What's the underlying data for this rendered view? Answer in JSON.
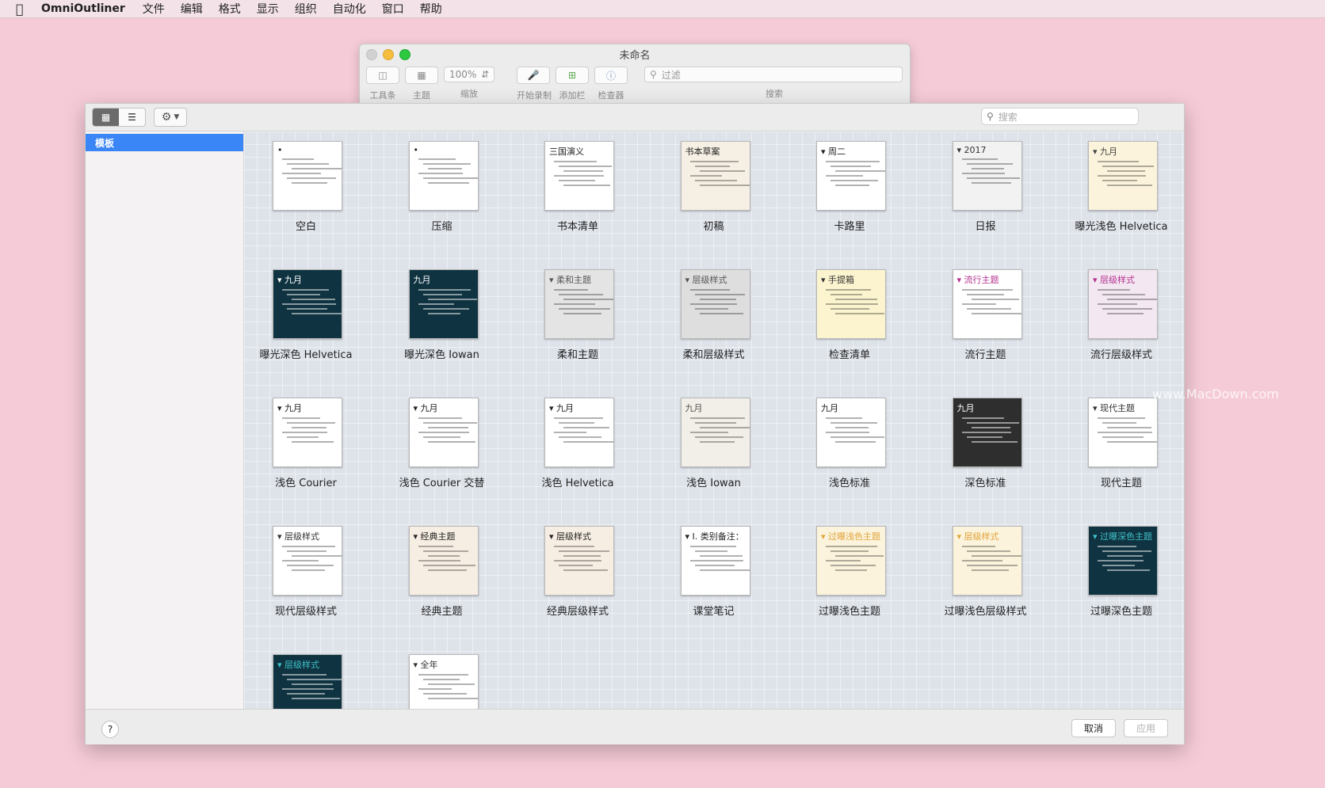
{
  "menubar": {
    "apple": "",
    "app_name": "OmniOutliner",
    "items": [
      "文件",
      "编辑",
      "格式",
      "显示",
      "组织",
      "自动化",
      "窗口",
      "帮助"
    ]
  },
  "doc_window": {
    "title": "未命名",
    "zoom_value": "100%",
    "toolbar_labels": {
      "toolbar": "工具条",
      "theme": "主题",
      "zoom": "缩放",
      "record": "开始录制",
      "add_column": "添加栏",
      "inspector": "检查器",
      "search": "搜索"
    },
    "filter_placeholder": "过滤"
  },
  "chooser": {
    "search_placeholder": "搜索",
    "sidebar_selected": "模板",
    "templates": [
      {
        "name": "空白",
        "bg": "#ffffff",
        "fg": "#222",
        "head": "•"
      },
      {
        "name": "压缩",
        "bg": "#ffffff",
        "fg": "#222",
        "head": "•"
      },
      {
        "name": "书本清单",
        "bg": "#ffffff",
        "fg": "#222",
        "head": "三国演义"
      },
      {
        "name": "初稿",
        "bg": "#f6efe4",
        "fg": "#222",
        "head": "书本草案"
      },
      {
        "name": "卡路里",
        "bg": "#ffffff",
        "fg": "#222",
        "head": "▾ 周二"
      },
      {
        "name": "日报",
        "bg": "#f2f2f2",
        "fg": "#333",
        "head": "▾ 2017"
      },
      {
        "name": "曝光浅色 Helvetica",
        "bg": "#fbf3dc",
        "fg": "#444",
        "head": "▾ 九月"
      },
      {
        "name": "曝光深色 Helvetica",
        "bg": "#0f3340",
        "fg": "#ffffff",
        "head": "▾ 九月"
      },
      {
        "name": "曝光深色 Iowan",
        "bg": "#0f3340",
        "fg": "#ffffff",
        "head": "九月"
      },
      {
        "name": "柔和主题",
        "bg": "#e4e4e4",
        "fg": "#555",
        "head": "▾ 柔和主题"
      },
      {
        "name": "柔和层级样式",
        "bg": "#dedede",
        "fg": "#555",
        "head": "▾ 层级样式"
      },
      {
        "name": "检查清单",
        "bg": "#fbf4cf",
        "fg": "#333",
        "head": "▾ 手提箱"
      },
      {
        "name": "流行主题",
        "bg": "#ffffff",
        "fg": "#b2308f",
        "head": "▾ 流行主题"
      },
      {
        "name": "流行层级样式",
        "bg": "#f3e8f1",
        "fg": "#b2308f",
        "head": "▾ 层级样式"
      },
      {
        "name": "浅色 Courier",
        "bg": "#ffffff",
        "fg": "#222",
        "head": "▾ 九月"
      },
      {
        "name": "浅色 Courier 交替",
        "bg": "#ffffff",
        "fg": "#222",
        "head": "▾ 九月"
      },
      {
        "name": "浅色 Helvetica",
        "bg": "#ffffff",
        "fg": "#222",
        "head": "▾ 九月"
      },
      {
        "name": "浅色 Iowan",
        "bg": "#f1efe8",
        "fg": "#555",
        "head": "九月"
      },
      {
        "name": "浅色标准",
        "bg": "#ffffff",
        "fg": "#222",
        "head": "九月"
      },
      {
        "name": "深色标准",
        "bg": "#2e2e2e",
        "fg": "#ffffff",
        "head": "九月"
      },
      {
        "name": "现代主题",
        "bg": "#ffffff",
        "fg": "#333",
        "head": "▾ 现代主题"
      },
      {
        "name": "现代层级样式",
        "bg": "#ffffff",
        "fg": "#333",
        "head": "▾ 层级样式"
      },
      {
        "name": "经典主题",
        "bg": "#f7eee3",
        "fg": "#222",
        "head": "▾ 经典主题"
      },
      {
        "name": "经典层级样式",
        "bg": "#f7eee3",
        "fg": "#222",
        "head": "▾ 层级样式"
      },
      {
        "name": "课堂笔记",
        "bg": "#ffffff",
        "fg": "#222",
        "head": "▾ I. 类别备注："
      },
      {
        "name": "过曝浅色主题",
        "bg": "#fbf3dc",
        "fg": "#e0a43a",
        "head": "▾ 过曝浅色主题"
      },
      {
        "name": "过曝浅色层级样式",
        "bg": "#fbf3dc",
        "fg": "#e0a43a",
        "head": "▾ 层级样式"
      },
      {
        "name": "过曝深色主题",
        "bg": "#0f3340",
        "fg": "#3fc1c9",
        "head": "▾ 过曝深色主题"
      },
      {
        "name": "",
        "bg": "#0f3340",
        "fg": "#3fc1c9",
        "head": "▾ 层级样式"
      },
      {
        "name": "",
        "bg": "#ffffff",
        "fg": "#333",
        "head": "▾ 全年"
      }
    ],
    "footer": {
      "help": "?",
      "cancel": "取消",
      "apply": "应用"
    }
  },
  "watermark": "www.MacDown.com"
}
